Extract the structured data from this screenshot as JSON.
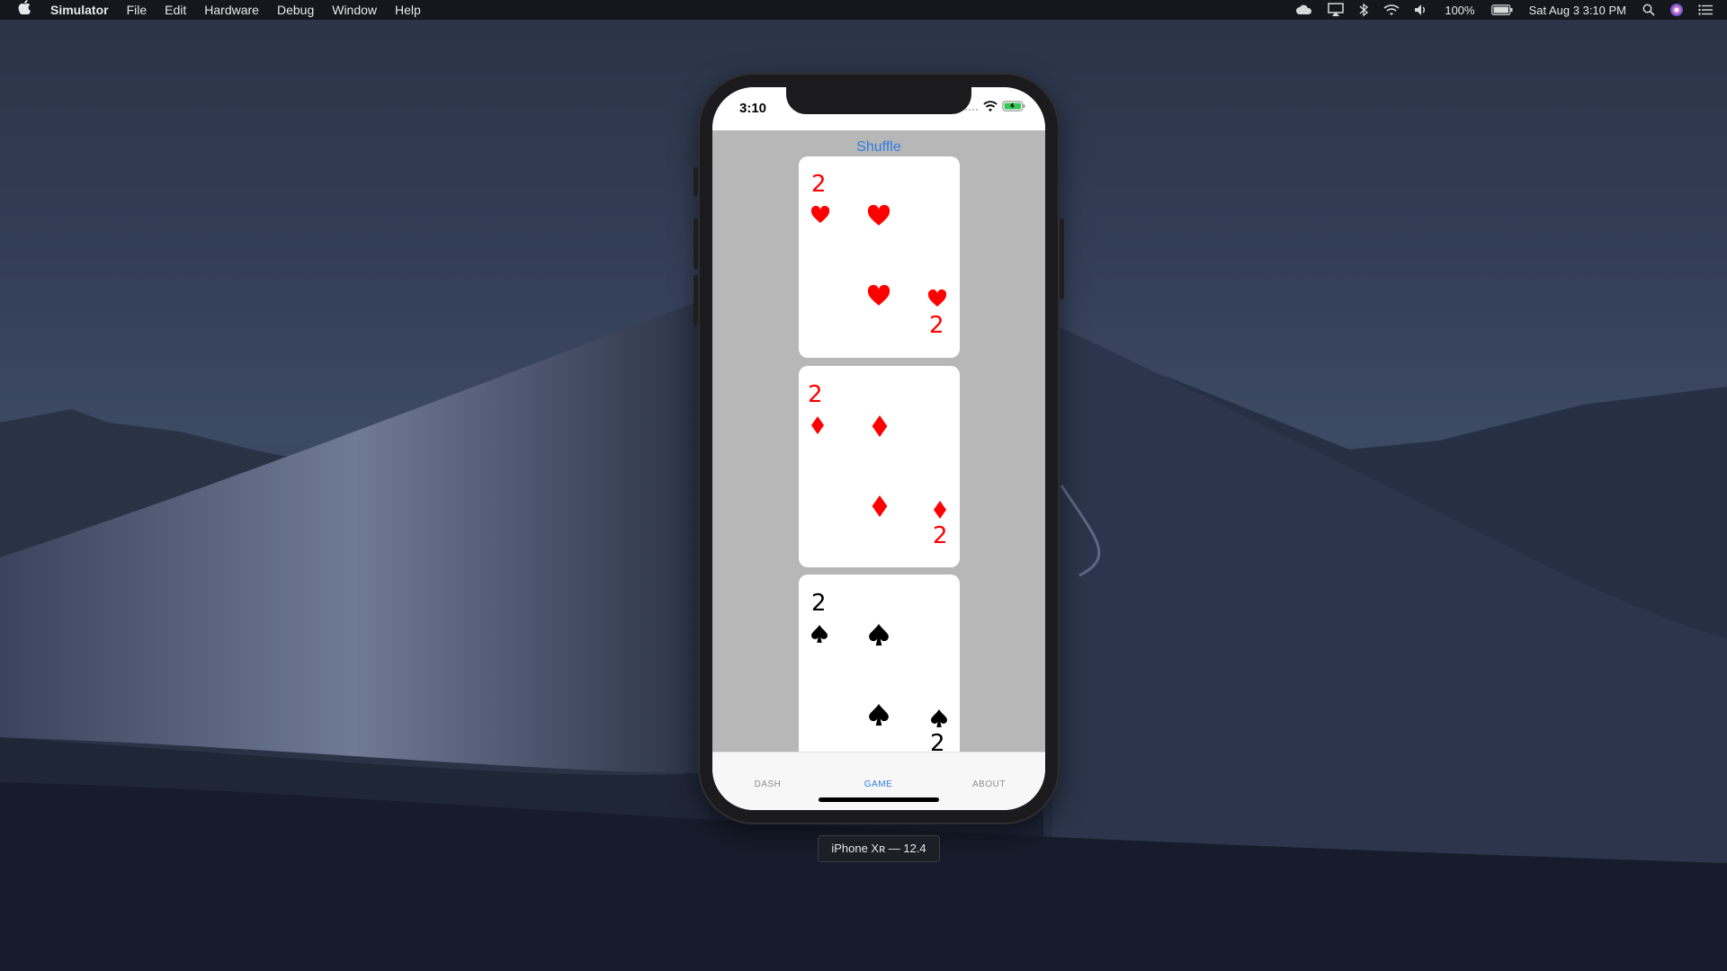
{
  "menubar": {
    "app_name": "Simulator",
    "items": [
      "File",
      "Edit",
      "Hardware",
      "Debug",
      "Window",
      "Help"
    ],
    "battery_text": "100%",
    "datetime": "Sat Aug 3  3:10 PM"
  },
  "device": {
    "status_time": "3:10",
    "label": "iPhone Xʀ — 12.4"
  },
  "app": {
    "shuffle_label": "Shuffle",
    "cards": [
      {
        "rank": "2",
        "suit": "hearts",
        "color": "#ff0000"
      },
      {
        "rank": "2",
        "suit": "diamonds",
        "color": "#ff0000"
      },
      {
        "rank": "2",
        "suit": "spades",
        "color": "#000000"
      }
    ],
    "tabs": [
      {
        "label": "DASH",
        "active": false
      },
      {
        "label": "GAME",
        "active": true
      },
      {
        "label": "ABOUT",
        "active": false
      }
    ]
  },
  "colors": {
    "accent": "#2f7de1",
    "content_bg": "#b7b7b7",
    "red_suit": "#ff0000",
    "black_suit": "#000000"
  }
}
